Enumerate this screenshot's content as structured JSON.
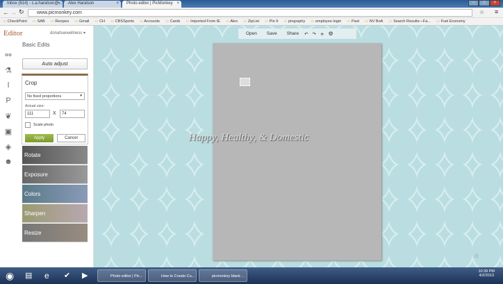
{
  "browser": {
    "tabs": [
      "Inbox (614) - c.a.haralson@...",
      "Alex Haralson",
      "Photo editor | PicMonkey"
    ],
    "url": "www.picmonkey.com",
    "bookmarks": [
      "CheckPoint",
      "SAB",
      "Recipes",
      "Gmail",
      "CH",
      "CBSSports",
      "Accounts",
      "Cards",
      "Imported From IE",
      "Alex",
      "ZipList",
      "Pin It",
      "pingraphy",
      "employee-login",
      "Past",
      "NV BoA",
      "Search Results—Fa...",
      "Fuel Economy"
    ]
  },
  "app": {
    "logo": "Editor",
    "user": "donahuewellness ▾",
    "section": "Basic Edits",
    "auto_adjust": "Auto adjust",
    "crop": {
      "title": "Crop",
      "proportions": "No fixed proportions",
      "size_label": "Actual size:",
      "width": "111",
      "height": "74",
      "x": "X",
      "scale_label": "Scale photo",
      "apply": "Apply",
      "cancel": "Cancel"
    },
    "tools": [
      "Rotate",
      "Exposure",
      "Colors",
      "Sharpen",
      "Resize"
    ],
    "toolbar": {
      "open": "Open",
      "save": "Save",
      "share": "Share"
    },
    "watermark": "Happy, Healthy, & Domestic"
  },
  "taskbar": {
    "items": [
      "Photo editor | Pic...",
      "How to Create Cu...",
      "picmonkey blank ..."
    ],
    "time": "10:39 PM",
    "date": "4/2/2013"
  }
}
